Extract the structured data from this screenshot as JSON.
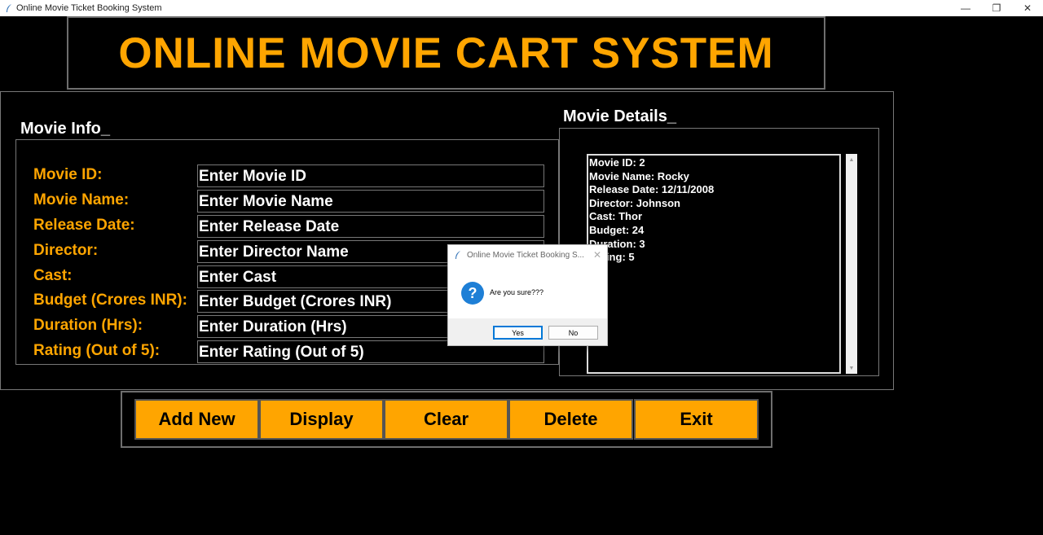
{
  "window": {
    "title": "Online Movie Ticket Booking System",
    "minimize_glyph": "—",
    "restore_glyph": "❐",
    "close_glyph": "✕"
  },
  "header": {
    "title": "ONLINE MOVIE CART SYSTEM"
  },
  "movie_info": {
    "title": "Movie Info_",
    "fields": [
      {
        "label": "Movie ID:",
        "placeholder": "Enter Movie ID"
      },
      {
        "label": "Movie Name:",
        "placeholder": "Enter Movie Name"
      },
      {
        "label": "Release Date:",
        "placeholder": "Enter Release Date"
      },
      {
        "label": "Director:",
        "placeholder": "Enter Director Name"
      },
      {
        "label": "Cast:",
        "placeholder": "Enter Cast"
      },
      {
        "label": "Budget (Crores INR):",
        "placeholder": "Enter Budget (Crores INR)"
      },
      {
        "label": "Duration (Hrs):",
        "placeholder": "Enter Duration (Hrs)"
      },
      {
        "label": "Rating (Out of 5):",
        "placeholder": "Enter Rating (Out of 5)"
      }
    ]
  },
  "movie_details": {
    "title": "Movie Details_",
    "lines": [
      "Movie ID: 2",
      "Movie Name: Rocky",
      "Release Date: 12/11/2008",
      "Director: Johnson",
      "Cast: Thor",
      "Budget: 24",
      "Duration: 3",
      "Rating: 5"
    ],
    "scroll_up_glyph": "▲",
    "scroll_down_glyph": "▼"
  },
  "buttons": {
    "add_new": "Add New",
    "display": "Display",
    "clear": "Clear",
    "delete": "Delete",
    "exit": "Exit"
  },
  "dialog": {
    "title": "Online Movie Ticket Booking S...",
    "close_glyph": "✕",
    "icon_glyph": "?",
    "message": "Are you sure???",
    "yes": "Yes",
    "no": "No"
  },
  "colors": {
    "accent": "#ffa500",
    "background": "#000000",
    "text": "#ffffff",
    "dialog_icon": "#1e7fd6"
  }
}
